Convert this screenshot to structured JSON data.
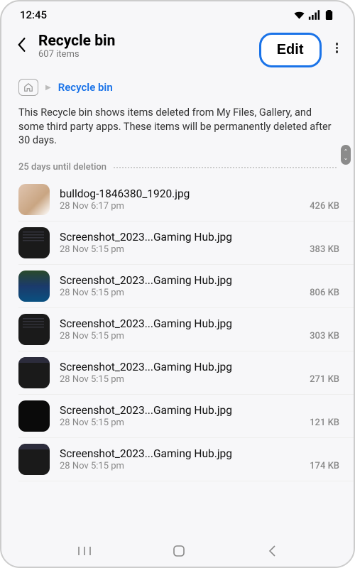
{
  "status": {
    "time": "12:45"
  },
  "header": {
    "title": "Recycle bin",
    "item_count": "607 items",
    "edit_label": "Edit"
  },
  "breadcrumb": {
    "current": "Recycle bin"
  },
  "info_text": "This Recycle bin shows items deleted from My Files, Gallery, and some third party apps. These items will be permanently deleted after 30 days.",
  "section": {
    "label": "25 days until deletion"
  },
  "files": [
    {
      "name": "bulldog-1846380_1920.jpg",
      "date": "28 Nov 6:17 pm",
      "size": "426 KB",
      "thumb": "photo"
    },
    {
      "name": "Screenshot_2023...Gaming Hub.jpg",
      "date": "28 Nov 5:15 pm",
      "size": "383 KB",
      "thumb": "darkblock"
    },
    {
      "name": "Screenshot_2023...Gaming Hub.jpg",
      "date": "28 Nov 5:15 pm",
      "size": "806 KB",
      "thumb": "colorful"
    },
    {
      "name": "Screenshot_2023...Gaming Hub.jpg",
      "date": "28 Nov 5:15 pm",
      "size": "303 KB",
      "thumb": "darkblock"
    },
    {
      "name": "Screenshot_2023...Gaming Hub.jpg",
      "date": "28 Nov 5:15 pm",
      "size": "271 KB",
      "thumb": "darktop"
    },
    {
      "name": "Screenshot_2023...Gaming Hub.jpg",
      "date": "28 Nov 5:15 pm",
      "size": "121 KB",
      "thumb": "plain"
    },
    {
      "name": "Screenshot_2023...Gaming Hub.jpg",
      "date": "28 Nov 5:15 pm",
      "size": "174 KB",
      "thumb": "darktop"
    }
  ]
}
